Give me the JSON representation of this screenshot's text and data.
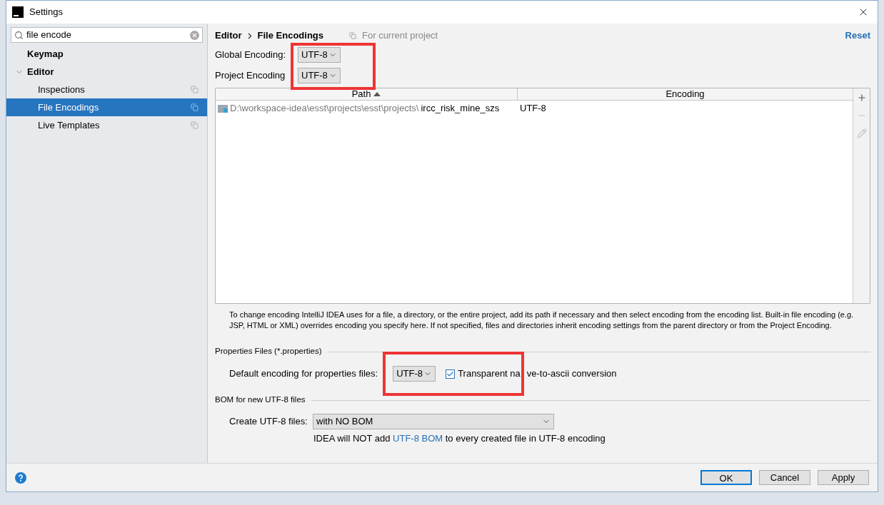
{
  "window": {
    "title": "Settings"
  },
  "search": {
    "value": "file encode"
  },
  "sidebar": {
    "items": [
      {
        "label": "Keymap",
        "selected": false
      },
      {
        "label": "Editor",
        "selected": false,
        "expanded": true,
        "children": [
          {
            "label": "Inspections",
            "selected": false
          },
          {
            "label": "File Encodings",
            "selected": true
          },
          {
            "label": "Live Templates",
            "selected": false
          }
        ]
      }
    ]
  },
  "breadcrumb": [
    "Editor",
    "File Encodings"
  ],
  "scope": "For current project",
  "reset": "Reset",
  "global_encoding": {
    "label": "Global Encoding:",
    "value": "UTF-8"
  },
  "project_encoding": {
    "label": "Project Encoding",
    "value": "UTF-8"
  },
  "table": {
    "columns": [
      {
        "label": "Path",
        "sorted": true
      },
      {
        "label": "Encoding",
        "sorted": false
      }
    ],
    "rows": [
      {
        "path_prefix": "D:\\workspace-idea\\esst\\projects\\esst\\projects\\",
        "path_name": "ircc_risk_mine_szs",
        "encoding": "UTF-8"
      }
    ],
    "toolbar": [
      {
        "kind": "add",
        "disabled": false
      },
      {
        "kind": "remove",
        "disabled": true
      },
      {
        "kind": "edit",
        "disabled": true
      }
    ]
  },
  "description": "To change encoding IntelliJ IDEA uses for a file, a directory, or the entire project, add its path if necessary and then select encoding from the encoding list. Built-in file encoding (e.g. JSP, HTML or XML) overrides encoding you specify here. If not specified, files and directories inherit encoding settings from the parent directory or from the Project Encoding.",
  "properties": {
    "title": "Properties Files (*.properties)",
    "label": "Default encoding for properties files:",
    "value": "UTF-8",
    "transparent": {
      "label_parts": [
        "Transparent na",
        "ve-to-ascii conversion"
      ],
      "checked": true
    }
  },
  "bom": {
    "title": "BOM for new UTF-8 files",
    "label": "Create UTF-8 files:",
    "value": "with NO BOM",
    "note_before": "IDEA will NOT add",
    "note_link": "UTF-8 BOM",
    "note_after": "to every created file in UTF-8 encoding"
  },
  "buttons": [
    {
      "label": "OK",
      "default": true
    },
    {
      "label": "Cancel",
      "default": false
    },
    {
      "label": "Apply",
      "default": false
    }
  ]
}
